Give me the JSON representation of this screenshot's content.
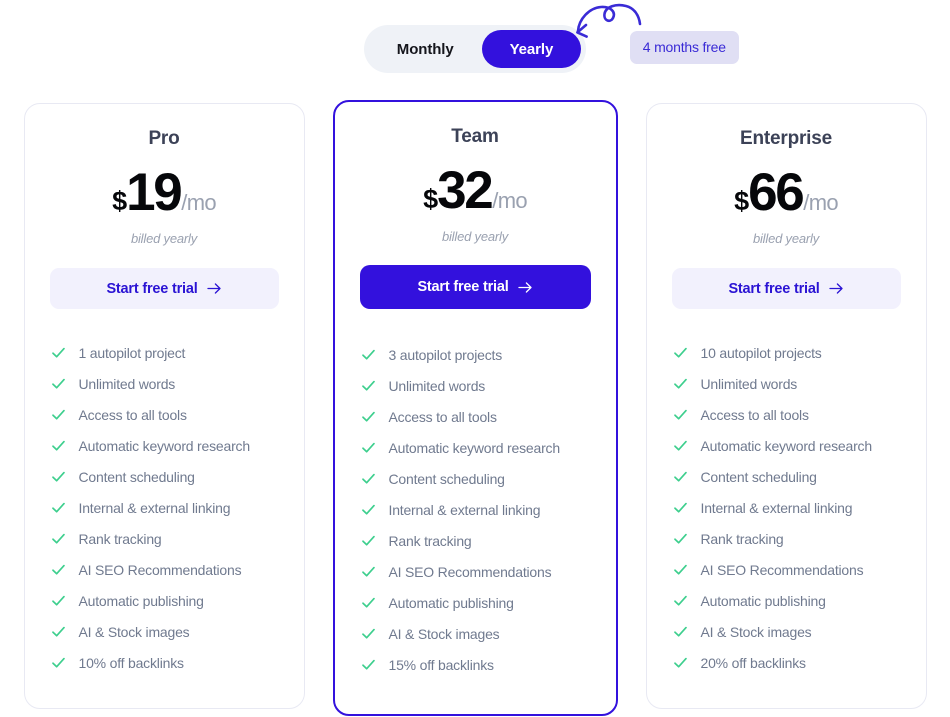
{
  "billing_toggle": {
    "monthly_label": "Monthly",
    "yearly_label": "Yearly",
    "active": "Yearly",
    "badge_label": "4 months free",
    "active_color": "#3311dd",
    "track_color": "#eff2f7",
    "badge_bg": "#e0dff4",
    "badge_color": "#3a2bd6"
  },
  "decoration": {
    "squiggle_arrow_color": "#3a2bd6",
    "icon": "curly-arrow-icon"
  },
  "cta": {
    "label": "Start free trial",
    "arrow": "arrow-right-icon"
  },
  "plans": [
    {
      "name": "Pro",
      "currency": "$",
      "amount": "19",
      "period": "/mo",
      "billing_note": "billed yearly",
      "featured": false,
      "features": [
        "1 autopilot project",
        "Unlimited words",
        "Access to all tools",
        "Automatic keyword research",
        "Content scheduling",
        "Internal & external linking",
        "Rank tracking",
        "AI SEO Recommendations",
        "Automatic publishing",
        "AI & Stock images",
        "10% off backlinks"
      ]
    },
    {
      "name": "Team",
      "currency": "$",
      "amount": "32",
      "period": "/mo",
      "billing_note": "billed yearly",
      "featured": true,
      "features": [
        "3 autopilot projects",
        "Unlimited words",
        "Access to all tools",
        "Automatic keyword research",
        "Content scheduling",
        "Internal & external linking",
        "Rank tracking",
        "AI SEO Recommendations",
        "Automatic publishing",
        "AI & Stock images",
        "15% off backlinks"
      ]
    },
    {
      "name": "Enterprise",
      "currency": "$",
      "amount": "66",
      "period": "/mo",
      "billing_note": "billed yearly",
      "featured": false,
      "features": [
        "10 autopilot projects",
        "Unlimited words",
        "Access to all tools",
        "Automatic keyword research",
        "Content scheduling",
        "Internal & external linking",
        "Rank tracking",
        "AI SEO Recommendations",
        "Automatic publishing",
        "AI & Stock images",
        "20% off backlinks"
      ]
    }
  ],
  "colors": {
    "accent": "#3311dd",
    "check_green": "#3ecf8e",
    "feature_text": "#707a8f",
    "plan_name": "#3c4257",
    "card_border": "#e8e9f3"
  }
}
